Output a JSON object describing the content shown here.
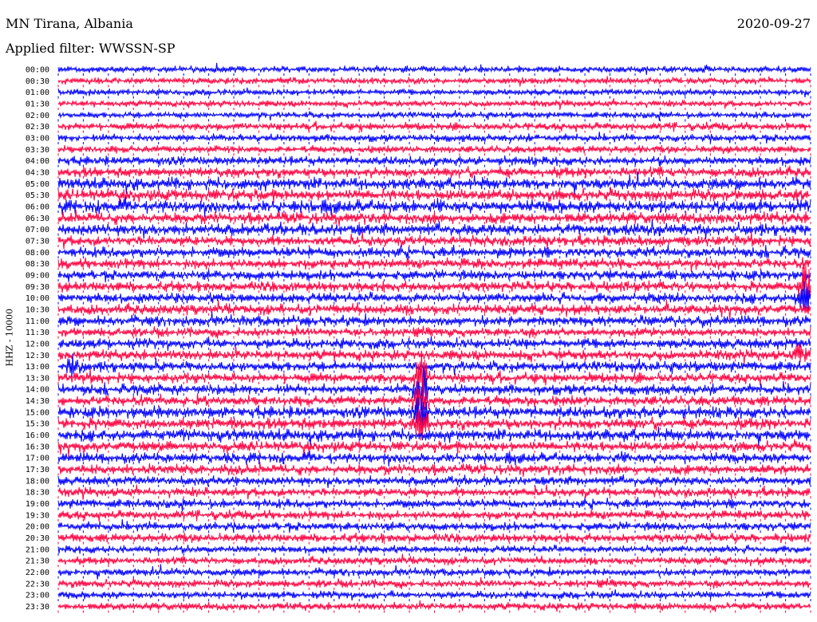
{
  "header": {
    "station": "MN Tirana, Albania",
    "date": "2020-09-27",
    "filter": "Applied filter: WWSSN-SP",
    "channel": "HHZ - 10000"
  },
  "colors": {
    "trace_a": "#0000ff",
    "trace_b": "#ff0040"
  },
  "chart_data": {
    "type": "line",
    "title": "MN Tirana, Albania",
    "subtitle": "Applied filter: WWSSN-SP",
    "ylabel": "HHZ - 10000",
    "y_tick_labels": [
      "00:00",
      "00:30",
      "01:00",
      "01:30",
      "02:00",
      "02:30",
      "03:00",
      "03:30",
      "04:00",
      "04:30",
      "05:00",
      "05:30",
      "06:00",
      "06:30",
      "07:00",
      "07:30",
      "08:00",
      "08:30",
      "09:00",
      "09:30",
      "10:00",
      "10:30",
      "11:00",
      "11:30",
      "12:00",
      "12:30",
      "13:00",
      "13:30",
      "14:00",
      "14:30",
      "15:00",
      "15:30",
      "16:00",
      "16:30",
      "17:00",
      "17:30",
      "18:00",
      "18:30",
      "19:00",
      "19:30",
      "20:00",
      "20:30",
      "21:00",
      "21:30",
      "22:00",
      "22:30",
      "23:00",
      "23:30"
    ],
    "trace_minutes": 30,
    "x_ticks_per_trace": 30,
    "series_colors_alternating": [
      "#0000ff",
      "#ff0040"
    ],
    "noise_amplitude_by_trace": [
      5,
      5,
      5,
      5,
      5,
      6,
      6,
      6,
      7,
      8,
      9,
      9,
      10,
      9,
      9,
      8,
      8,
      8,
      8,
      8,
      8,
      8,
      8,
      7,
      8,
      8,
      8,
      8,
      8,
      8,
      9,
      9,
      9,
      8,
      8,
      8,
      7,
      7,
      7,
      7,
      7,
      7,
      6,
      6,
      6,
      6,
      6,
      6
    ],
    "events": [
      {
        "start": "09:30",
        "x_fraction": 0.993,
        "amplitude": 30
      },
      {
        "start": "10:00",
        "x_fraction": 0.99,
        "amplitude": 20
      },
      {
        "start": "12:30",
        "x_fraction": 0.988,
        "amplitude": 10
      },
      {
        "start": "13:00",
        "x_fraction": 0.02,
        "amplitude": 10
      },
      {
        "start": "13:30",
        "x_fraction": 0.482,
        "amplitude": 30
      },
      {
        "start": "14:00",
        "x_fraction": 0.482,
        "amplitude": 30
      },
      {
        "start": "14:30",
        "x_fraction": 0.482,
        "amplitude": 30
      },
      {
        "start": "15:00",
        "x_fraction": 0.482,
        "amplitude": 24
      },
      {
        "start": "15:30",
        "x_fraction": 0.482,
        "amplitude": 16
      }
    ],
    "grid": false
  }
}
